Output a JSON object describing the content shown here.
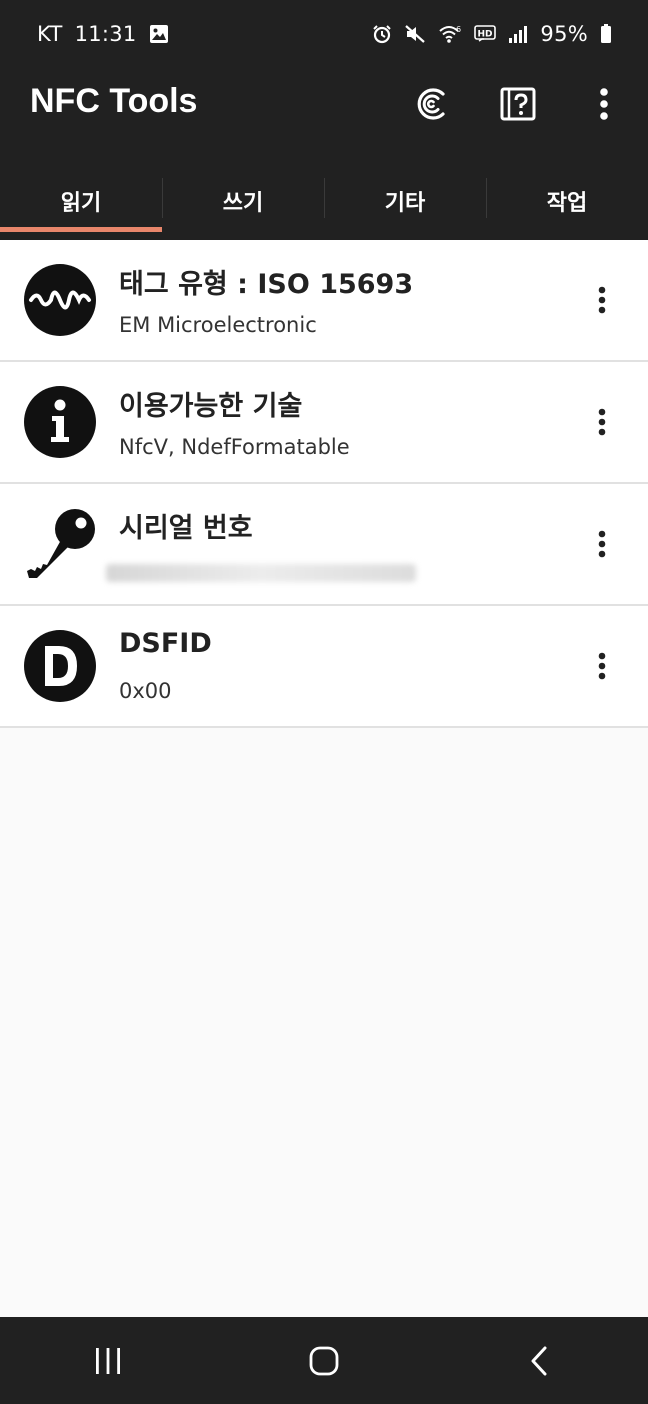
{
  "status_bar": {
    "carrier": "KT",
    "time": "11:31",
    "battery": "95%"
  },
  "app_bar": {
    "title": "NFC Tools"
  },
  "tabs": [
    {
      "label": "읽기",
      "active": true
    },
    {
      "label": "쓰기",
      "active": false
    },
    {
      "label": "기타",
      "active": false
    },
    {
      "label": "작업",
      "active": false
    }
  ],
  "records": [
    {
      "title": "태그 유형 : ISO 15693",
      "subtitle": "EM Microelectronic",
      "icon": "waveform-icon"
    },
    {
      "title": "이용가능한 기술",
      "subtitle": "NfcV, NdefFormatable",
      "icon": "info-icon"
    },
    {
      "title": "시리얼 번호",
      "subtitle": "",
      "icon": "key-icon"
    },
    {
      "title": "DSFID",
      "subtitle": "0x00",
      "icon": "letter-d-icon"
    }
  ],
  "colors": {
    "bar_background": "#212121",
    "tab_indicator": "#e8866b",
    "content_background": "#fafafa"
  }
}
